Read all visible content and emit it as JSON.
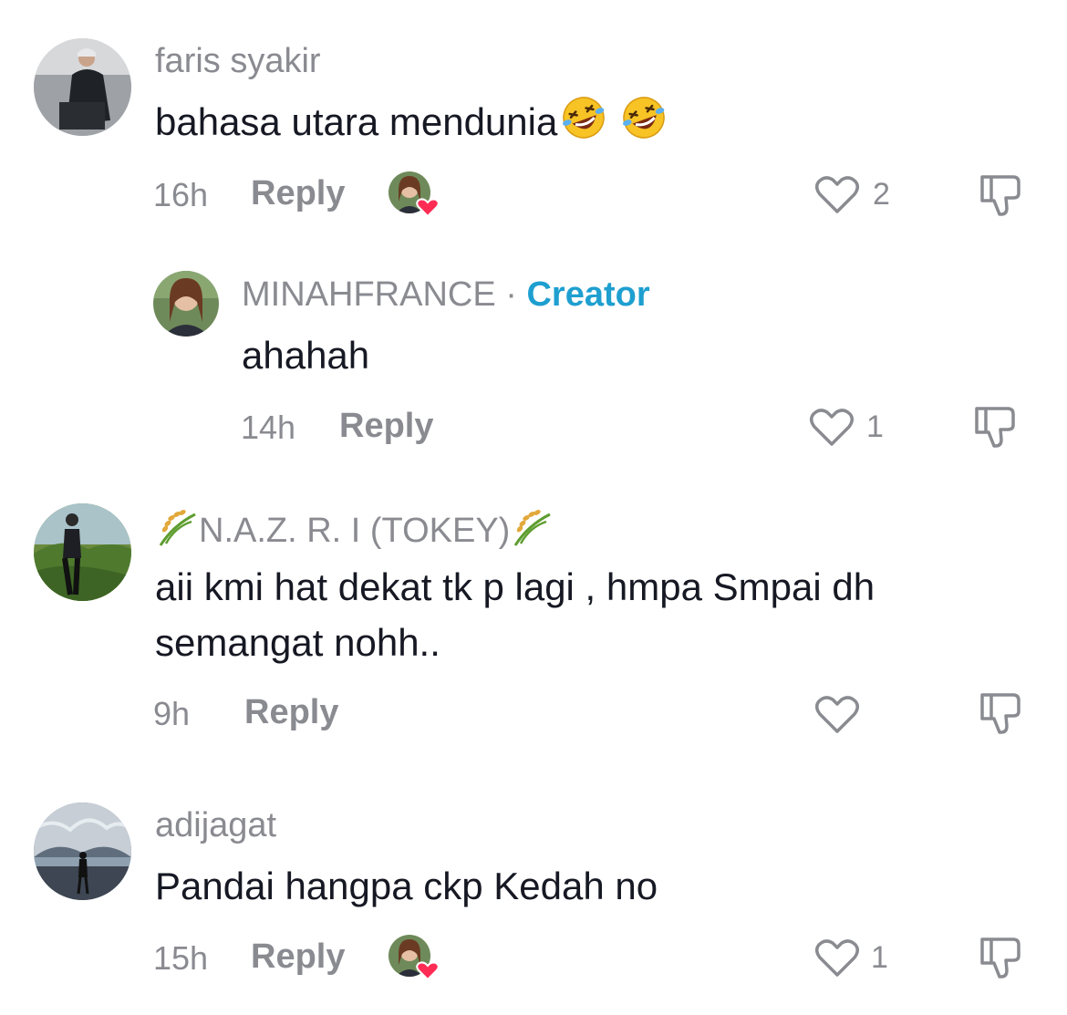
{
  "colors": {
    "text": "#161823",
    "muted": "#8a8b91",
    "creator": "#1e9fd0",
    "heart_badge": "#fe2c55"
  },
  "comments": [
    {
      "username": "faris syakir",
      "text": "bahasa utara mendunia",
      "emoji": [
        "rolling-on-floor-laughing",
        "rolling-on-floor-laughing"
      ],
      "time": "16h",
      "reply_label": "Reply",
      "liked_by_creator": true,
      "likes": "2"
    },
    {
      "username": "MINAHFRANCE",
      "separator": "·",
      "badge": "Creator",
      "text": "ahahah",
      "time": "14h",
      "reply_label": "Reply",
      "likes": "1"
    },
    {
      "username": "N.A.Z. R. I (TOKEY)",
      "username_icons": [
        "rice-sheaf",
        "rice-sheaf"
      ],
      "text_line1": "aii kmi hat dekat tk p lagi , hmpa Smpai dh",
      "text_line2": "semangat nohh..",
      "time": "9h",
      "reply_label": "Reply",
      "likes": ""
    },
    {
      "username": "adijagat",
      "text": "Pandai hangpa ckp Kedah no",
      "time": "15h",
      "reply_label": "Reply",
      "liked_by_creator": true,
      "likes": "1"
    }
  ]
}
